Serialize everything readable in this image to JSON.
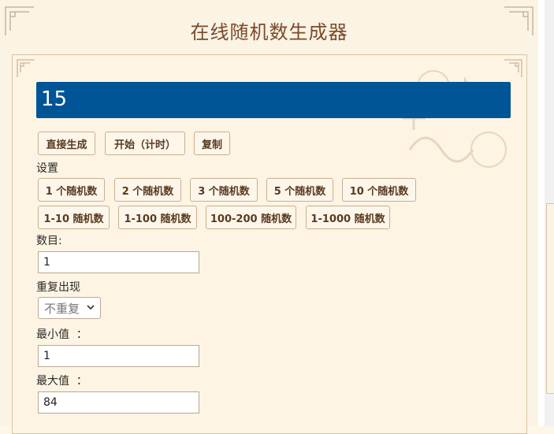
{
  "header": {
    "title": "在线随机数生成器"
  },
  "result": {
    "value": "15"
  },
  "actions": {
    "generate": "直接生成",
    "start_timer": "开始（计时）",
    "copy": "复制"
  },
  "settings": {
    "label": "设置",
    "count_presets": [
      "1 个随机数",
      "2 个随机数",
      "3 个随机数",
      "5 个随机数",
      "10 个随机数"
    ],
    "range_presets": [
      "1-10 随机数",
      "1-100 随机数",
      "100-200 随机数",
      "1-1000 随机数"
    ]
  },
  "form": {
    "count_label": "数目:",
    "count_value": "1",
    "repeat_label": "重复出现",
    "repeat_selected": "不重复",
    "min_label": "最小值  ：",
    "min_value": "1",
    "max_label": "最大值  ：",
    "max_value": "84"
  },
  "colors": {
    "result_bg": "#005597",
    "title": "#7a4a2a",
    "button_text": "#5a3a20"
  }
}
